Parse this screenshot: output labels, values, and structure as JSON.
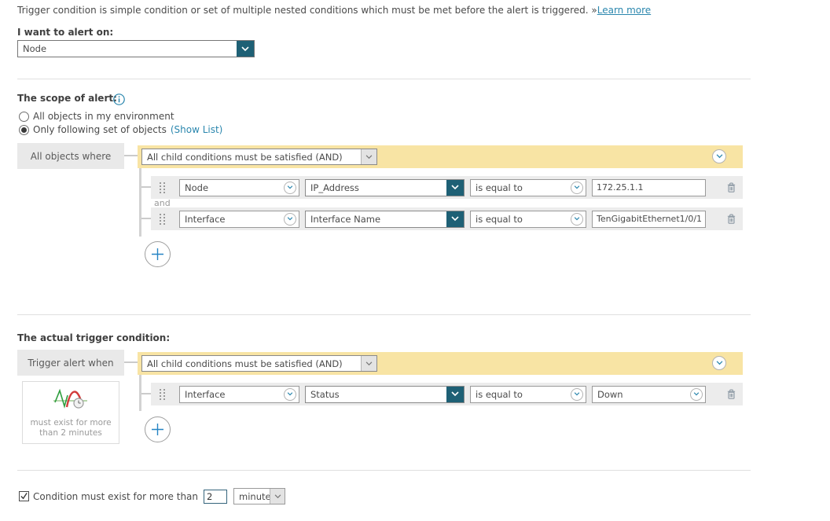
{
  "intro": {
    "text": "Trigger condition is simple condition or set of multiple nested conditions which must be met before the alert is triggered.",
    "link_prefix": "»",
    "learn_more": "Learn more"
  },
  "alert_on": {
    "label": "I want to alert on:",
    "value": "Node"
  },
  "scope": {
    "heading": "The scope of alert:",
    "radio_all": "All objects in my environment",
    "radio_subset": "Only following set of objects",
    "show_list": "(Show List)",
    "builder_label": "All objects where",
    "group_condition": "All child conditions must be satisfied (AND)",
    "and_label": "and",
    "rows": [
      {
        "object": "Node",
        "field": "IP_Address",
        "operator": "is equal to",
        "value": "172.25.1.1"
      },
      {
        "object": "Interface",
        "field": "Interface Name",
        "operator": "is equal to",
        "value": "TenGigabitEthernet1/0/1"
      }
    ]
  },
  "trigger": {
    "heading": "The actual trigger condition:",
    "builder_label": "Trigger alert when",
    "group_condition": "All child conditions must be satisfied (AND)",
    "note_line1": "must exist for more",
    "note_line2": "than 2 minutes",
    "rows": [
      {
        "object": "Interface",
        "field": "Status",
        "operator": "is equal to",
        "value": "Down"
      }
    ]
  },
  "duration": {
    "checked": true,
    "label": "Condition must exist for more than",
    "value": "2",
    "unit": "minutes"
  },
  "icons": {
    "dropdown": "chevron-down",
    "info": "info-circle",
    "delete": "trash",
    "add": "plus",
    "drag": "grip-dots",
    "duration": "waveform-clock"
  },
  "colors": {
    "accent_teal": "#1e6075",
    "group_bar_yellow": "#f8e4a4",
    "link_blue": "#2b87ae",
    "row_gray": "#ececec"
  }
}
